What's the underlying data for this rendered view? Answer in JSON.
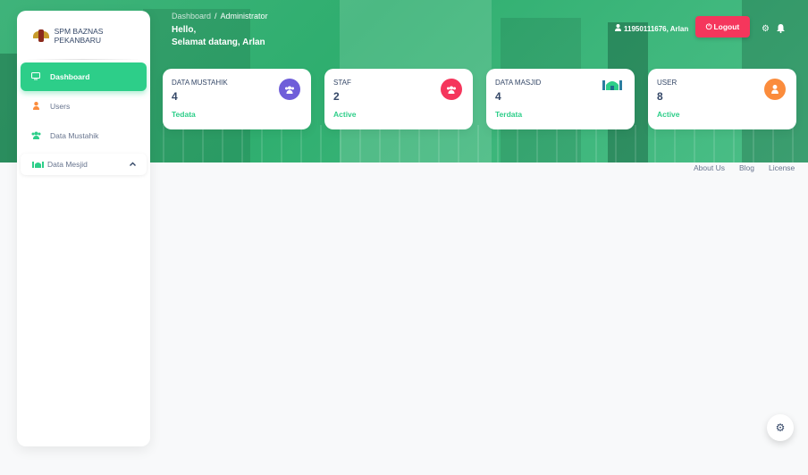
{
  "header": {
    "breadcrumb": {
      "parent": "Dashboard",
      "separator": "/",
      "current": "Administrator"
    },
    "greeting_line1": "Hello,",
    "greeting_line2": "Selamat datang, Arlan",
    "user_label": "11950111676, Arlan",
    "logout_label": "Logout",
    "icons": [
      "user-icon",
      "power-icon",
      "gear-icon",
      "bell-icon"
    ]
  },
  "sidebar": {
    "brand": "SPM BAZNAS PEKANBARU",
    "items": [
      {
        "label": "Dashboard",
        "icon": "monitor-icon",
        "active": true
      },
      {
        "label": "Users",
        "icon": "user-icon",
        "active": false
      },
      {
        "label": "Data Mustahik",
        "icon": "users-icon",
        "active": false
      },
      {
        "label": "Data Mesjid",
        "icon": "mosque-icon",
        "active": false,
        "expandable": true
      }
    ]
  },
  "cards": [
    {
      "title": "DATA MUSTAHIK",
      "value": "4",
      "status": "Tedata",
      "color": "#6f5ed9",
      "icon": "users-icon"
    },
    {
      "title": "STAF",
      "value": "2",
      "status": "Active",
      "color": "#f5365c",
      "icon": "users-icon"
    },
    {
      "title": "DATA MASJID",
      "value": "4",
      "status": "Terdata",
      "color": "#2dce89",
      "icon": "mosque-icon"
    },
    {
      "title": "USER",
      "value": "8",
      "status": "Active",
      "color": "#fb8c3c",
      "icon": "user-icon"
    }
  ],
  "footer": {
    "links": [
      "About Us",
      "Blog",
      "License"
    ]
  },
  "colors": {
    "accent": "#2dce89",
    "danger": "#f5365c",
    "text": "#344767"
  }
}
